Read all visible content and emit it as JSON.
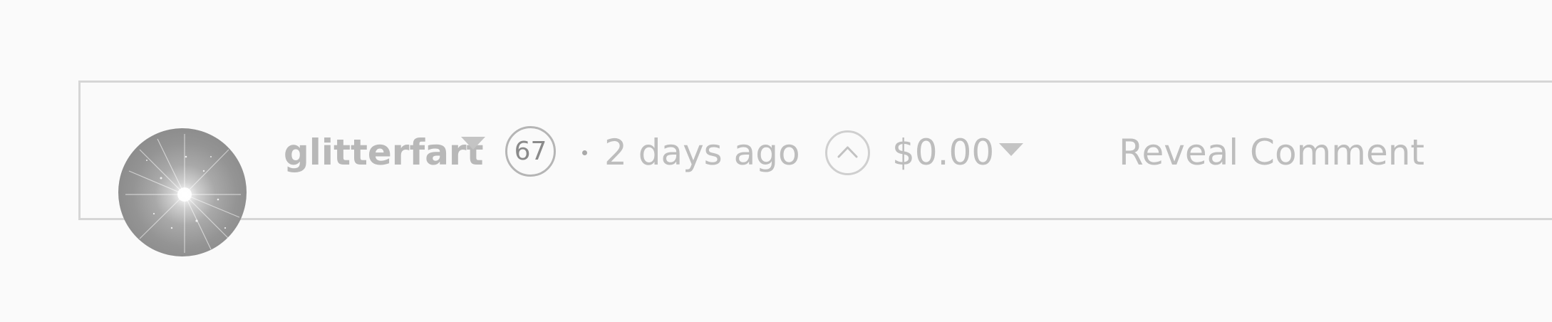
{
  "comment": {
    "author": "glitterfart",
    "reputation": "67",
    "separator": "·",
    "timestamp": "2 days ago",
    "payout": "$0.00",
    "reveal_label": "Reveal Comment"
  },
  "icons": {
    "avatar": "sparkle-avatar-image",
    "author_menu": "caret-down-icon",
    "upvote": "chevron-up-icon",
    "payout_menu": "caret-down-icon"
  },
  "colors": {
    "background": "#fafafa",
    "border": "#d6d6d6",
    "muted_text": "#bdbdbd",
    "reputation_text": "#8a8a8a"
  }
}
